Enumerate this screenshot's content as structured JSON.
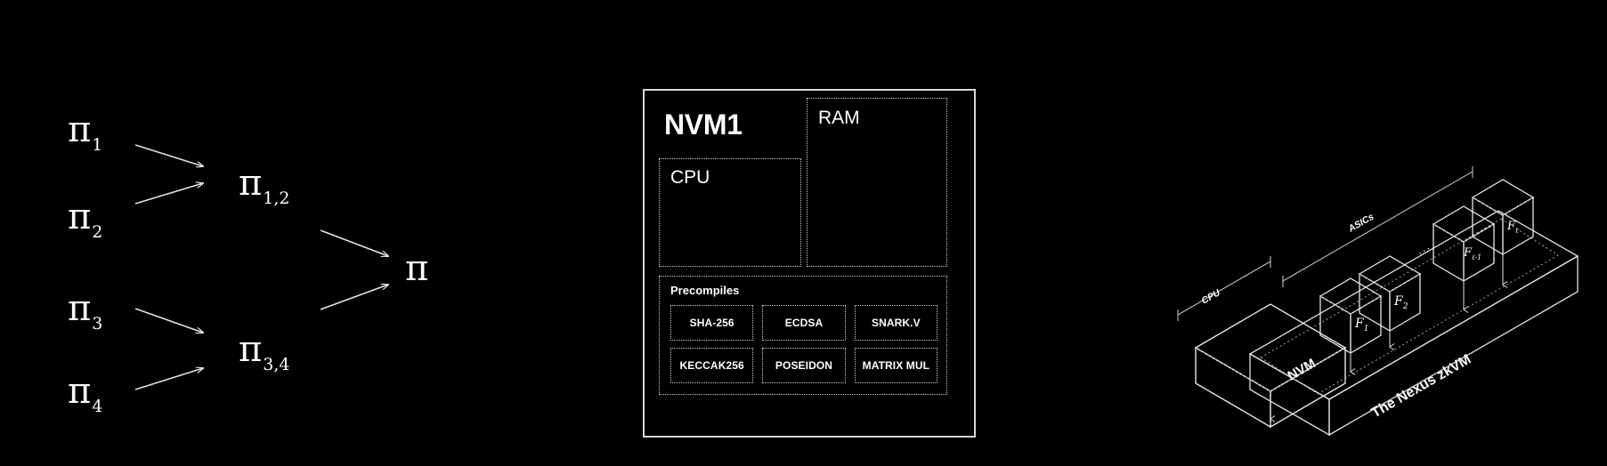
{
  "figure": {
    "background_color": "#000000",
    "foreground_color": "#ffffff",
    "panel_border_color": "#d7d7d7",
    "dotted_border_color": "#cfcfcf"
  },
  "tree": {
    "name": "proof-aggregation-tree",
    "leaves": [
      {
        "symbol": "π",
        "subscript": "1"
      },
      {
        "symbol": "π",
        "subscript": "2"
      },
      {
        "symbol": "π",
        "subscript": "3"
      },
      {
        "symbol": "π",
        "subscript": "4"
      }
    ],
    "intermediates": [
      {
        "symbol": "π",
        "subscript": "1,2"
      },
      {
        "symbol": "π",
        "subscript": "3,4"
      }
    ],
    "root": {
      "symbol": "π",
      "subscript": ""
    },
    "arrow_count": 6
  },
  "nvm": {
    "title": "NVM1",
    "cpu": {
      "label": "CPU"
    },
    "ram": {
      "label": "RAM"
    },
    "precompiles": {
      "label": "Precompiles",
      "items": [
        "SHA-256",
        "ECDSA",
        "SNARK.V",
        "KECCAK256",
        "POSEIDON",
        "MATRIX MUL"
      ]
    }
  },
  "iso": {
    "platform_label": "The Nexus zkVM",
    "nvm_label": "NVM",
    "cpu_bracket_label": "CPU",
    "asics_bracket_label": "ASICs",
    "ellipsis": "···",
    "cubes": [
      {
        "base": "F",
        "sub": "1"
      },
      {
        "base": "F",
        "sub": "2"
      },
      {
        "base": "F",
        "sub": "ℓ-1"
      },
      {
        "base": "F",
        "sub": "ℓ"
      }
    ]
  }
}
